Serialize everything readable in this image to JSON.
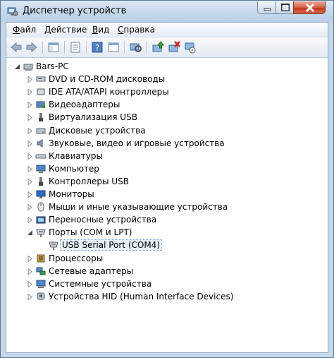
{
  "window": {
    "title": "Диспетчер устройств"
  },
  "menu": [
    {
      "label": "Файл",
      "accel": "Ф",
      "rest": "айл"
    },
    {
      "label": "Действие",
      "accel": "Д",
      "rest": "ействие"
    },
    {
      "label": "Вид",
      "accel": "В",
      "rest": "ид"
    },
    {
      "label": "Справка",
      "accel": "С",
      "rest": "правка"
    }
  ],
  "toolbar": [
    "back-icon",
    "forward-icon",
    "show-hide-console-tree-icon",
    "properties-icon",
    "help-icon",
    "scan-hardware-icon",
    "update-driver-icon",
    "uninstall-icon",
    "disable-icon"
  ],
  "tree": {
    "root": "Bars-PC",
    "categories": [
      {
        "label": "DVD и CD-ROM дисководы",
        "icon": "dvd-drive-icon"
      },
      {
        "label": "IDE ATA/ATAPI контроллеры",
        "icon": "ide-controller-icon"
      },
      {
        "label": "Видеоадаптеры",
        "icon": "display-adapter-icon"
      },
      {
        "label": "Виртуализация USB",
        "icon": "usb-virtualization-icon"
      },
      {
        "label": "Дисковые устройства",
        "icon": "disk-drive-icon"
      },
      {
        "label": "Звуковые, видео и игровые устройства",
        "icon": "sound-icon"
      },
      {
        "label": "Клавиатуры",
        "icon": "keyboard-icon"
      },
      {
        "label": "Компьютер",
        "icon": "computer-icon"
      },
      {
        "label": "Контроллеры USB",
        "icon": "usb-controller-icon"
      },
      {
        "label": "Мониторы",
        "icon": "monitor-icon"
      },
      {
        "label": "Мыши и иные указывающие устройства",
        "icon": "mouse-icon"
      },
      {
        "label": "Переносные устройства",
        "icon": "portable-device-icon"
      },
      {
        "label": "Порты (COM и LPT)",
        "icon": "port-icon",
        "expanded": true,
        "children": [
          {
            "label": "USB Serial Port (COM4)",
            "icon": "port-icon",
            "selected": true
          }
        ]
      },
      {
        "label": "Процессоры",
        "icon": "processor-icon"
      },
      {
        "label": "Сетевые адаптеры",
        "icon": "network-adapter-icon"
      },
      {
        "label": "Системные устройства",
        "icon": "system-device-icon"
      },
      {
        "label": "Устройства HID (Human Interface Devices)",
        "icon": "hid-icon"
      }
    ]
  }
}
